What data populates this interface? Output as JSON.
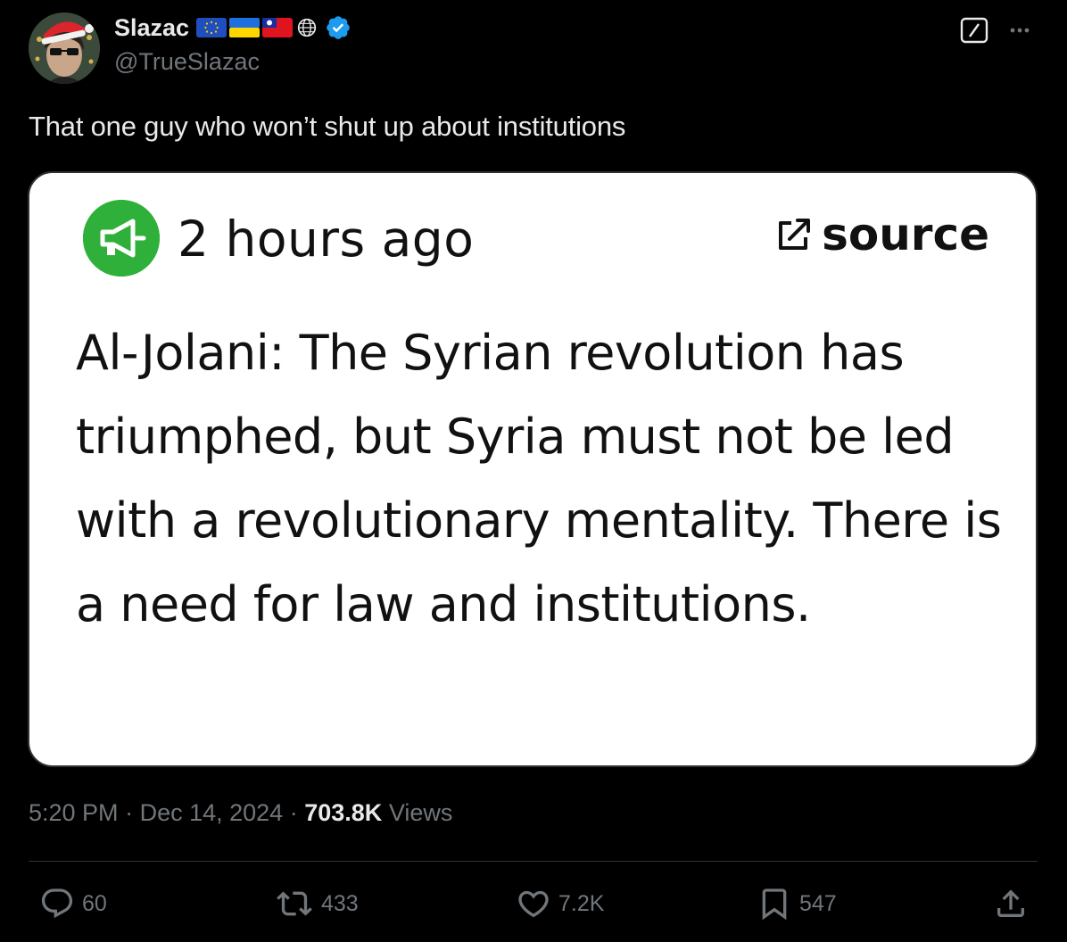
{
  "author": {
    "display_name": "Slazac",
    "handle": "@TrueSlazac",
    "verified": true,
    "flags": [
      "eu-flag-icon",
      "ukraine-flag-icon",
      "taiwan-flag-icon",
      "globe-icon"
    ]
  },
  "tweet": {
    "text": "That one guy who won’t shut up about institutions",
    "time": "5:20 PM",
    "date": "Dec 14, 2024",
    "views_count": "703.8K",
    "views_label": "Views"
  },
  "card": {
    "time_ago": "2 hours ago",
    "source_label": "source",
    "headline": "Al-Jolani: The Syrian revolution has triumphed, but Syria must not be led with a revolutionary mentality. There is a need for law and institutions.",
    "icon": "megaphone-icon",
    "accent_color": "#2fb03a"
  },
  "actions": {
    "replies": "60",
    "reposts": "433",
    "likes": "7.2K",
    "bookmarks": "547"
  },
  "colors": {
    "background": "#000000",
    "text": "#e7e9ea",
    "secondary": "#71767b",
    "verified": "#1d9bf0"
  }
}
